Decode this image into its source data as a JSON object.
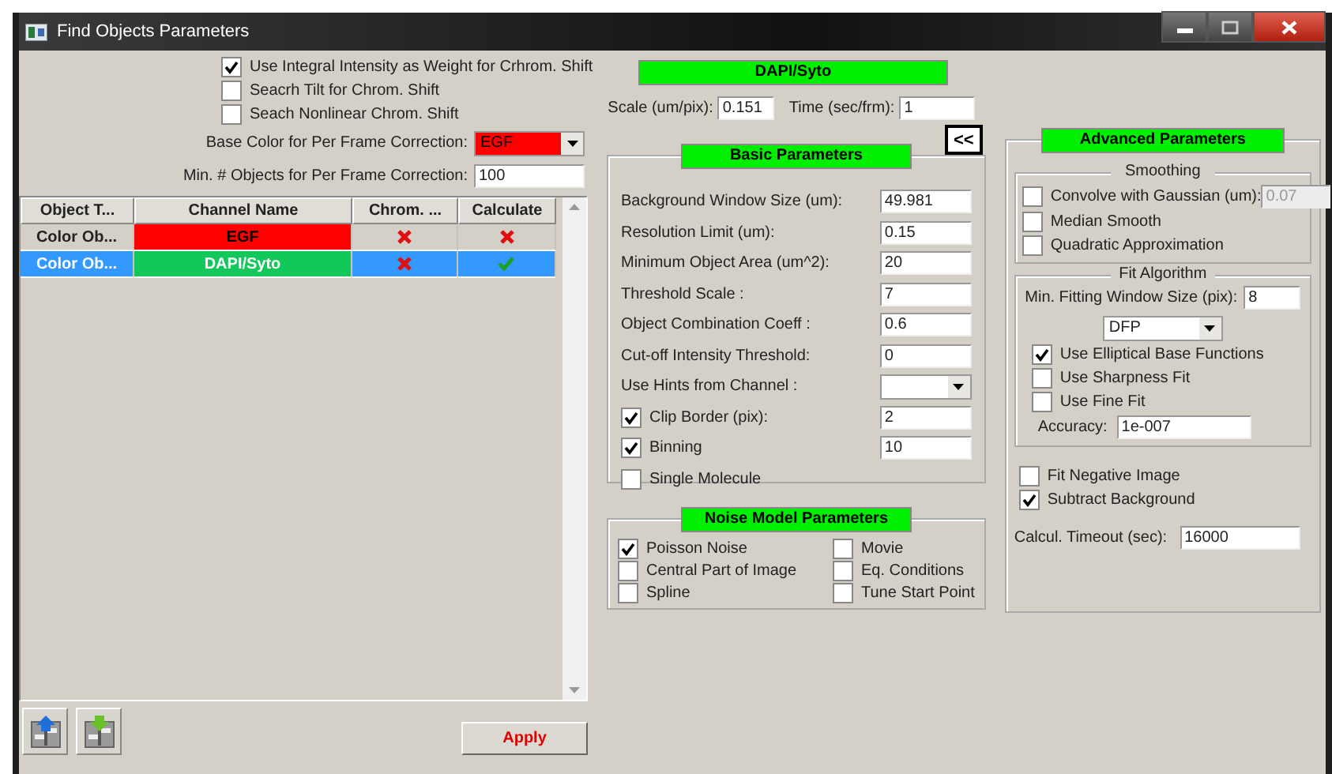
{
  "window": {
    "title": "Find Objects Parameters"
  },
  "options": {
    "checks": [
      {
        "label": "Use Integral Intensity as Weight for Crhrom. Shift",
        "checked": true
      },
      {
        "label": "Seacrh Tilt for Chrom. Shift",
        "checked": false
      },
      {
        "label": "Seach Nonlinear Chrom. Shift",
        "checked": false
      }
    ],
    "base_color": {
      "label": "Base Color for Per Frame Correction:",
      "value": "EGF",
      "color": "#ff0000"
    },
    "min_objects": {
      "label": "Min. # Objects for Per Frame Correction:",
      "value": "100"
    }
  },
  "table": {
    "columns": [
      "Object T...",
      "Channel Name",
      "Chrom. ...",
      "Calculate"
    ],
    "rows": [
      {
        "object_type": "Color Ob...",
        "channel_name": "EGF",
        "color": "#ff0000",
        "chrom_shift": false,
        "calculate": false,
        "selected": false
      },
      {
        "object_type": "Color Ob...",
        "channel_name": "DAPI/Syto",
        "color": "#13c85a",
        "chrom_shift": false,
        "calculate": true,
        "selected": true
      }
    ]
  },
  "channel": {
    "title": "DAPI/Syto",
    "scale": {
      "label": "Scale (um/pix):",
      "value": "0.151"
    },
    "time": {
      "label": "Time (sec/frm):",
      "value": "1"
    },
    "collapse_button": "<<"
  },
  "basic": {
    "title": "Basic Parameters",
    "rows": [
      {
        "kind": "field",
        "label": "Background Window Size (um):",
        "value": "49.981"
      },
      {
        "kind": "field",
        "label": "Resolution Limit (um):",
        "value": "0.15"
      },
      {
        "kind": "field",
        "label": "Minimum Object Area (um^2):",
        "value": "20"
      },
      {
        "kind": "field",
        "label": "Threshold Scale :",
        "value": "7"
      },
      {
        "kind": "field",
        "label": "Object Combination Coeff :",
        "value": "0.6"
      },
      {
        "kind": "field",
        "label": "Cut-off Intensity Threshold:",
        "value": "0"
      },
      {
        "kind": "dropdown",
        "label": "Use Hints from Channel :"
      },
      {
        "kind": "check_field",
        "label": "Clip Border (pix):",
        "checked": true,
        "value": "2"
      },
      {
        "kind": "check_field",
        "label": "Binning",
        "checked": true,
        "value": "10"
      },
      {
        "kind": "check",
        "label": "Single Molecule",
        "checked": false
      }
    ]
  },
  "noise": {
    "title": "Noise Model Parameters",
    "options": [
      {
        "label": "Poisson Noise",
        "checked": true
      },
      {
        "label": "Movie",
        "checked": false
      },
      {
        "label": "Central Part of Image",
        "checked": false
      },
      {
        "label": "Eq. Conditions",
        "checked": false
      },
      {
        "label": "Spline",
        "checked": false
      },
      {
        "label": "Tune Start Point",
        "checked": false
      }
    ]
  },
  "advanced": {
    "title": "Advanced Parameters",
    "smoothing": {
      "title": "Smoothing",
      "items": [
        {
          "kind": "check_field",
          "label": "Convolve with Gaussian (um):",
          "checked": false,
          "value": "0.07",
          "disabled": true
        },
        {
          "kind": "check",
          "label": "Median Smooth",
          "checked": false
        },
        {
          "kind": "check",
          "label": "Quadratic Approximation",
          "checked": false
        }
      ]
    },
    "fit": {
      "title": "Fit Algorithm",
      "min_window": {
        "label": "Min. Fitting Window Size (pix):",
        "value": "8"
      },
      "method": "DFP",
      "checks": [
        {
          "label": "Use Elliptical Base Functions",
          "checked": true
        },
        {
          "label": "Use Sharpness Fit",
          "checked": false
        },
        {
          "label": "Use Fine Fit",
          "checked": false
        }
      ],
      "accuracy": {
        "label": "Accuracy:",
        "value": "1e-007"
      }
    },
    "checks": [
      {
        "label": "Fit Negative Image",
        "checked": false
      },
      {
        "label": "Subtract Background",
        "checked": true
      }
    ],
    "timeout": {
      "label": "Calcul. Timeout (sec):",
      "value": "16000"
    }
  },
  "apply_button": "Apply"
}
